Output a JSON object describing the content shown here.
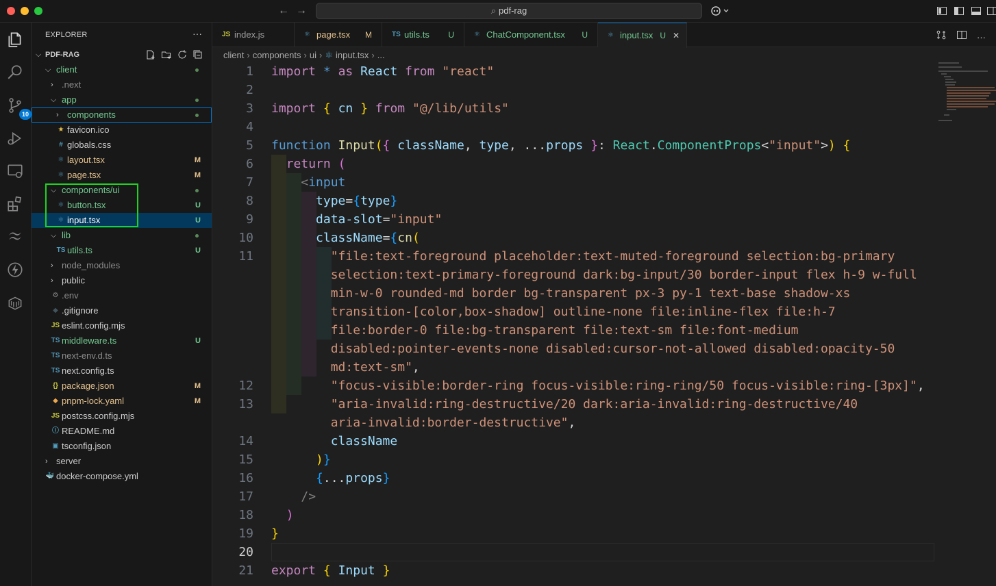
{
  "window": {
    "search_text": "pdf-rag"
  },
  "activity_bar": {
    "items": [
      {
        "name": "explorer-icon"
      },
      {
        "name": "search-icon"
      },
      {
        "name": "source-control-icon",
        "badge": "10"
      },
      {
        "name": "run-debug-icon"
      },
      {
        "name": "remote-explorer-icon"
      },
      {
        "name": "extensions-icon"
      },
      {
        "name": "tailwind-icon"
      },
      {
        "name": "thunder-icon"
      },
      {
        "name": "docker-icon"
      }
    ]
  },
  "sidebar": {
    "title": "EXPLORER",
    "more": "···",
    "root": "PDF-RAG",
    "tree": [
      {
        "label": "client",
        "indent": 1,
        "kind": "folder-open",
        "color": "#73c991",
        "dot": true
      },
      {
        "label": ".next",
        "indent": 2,
        "kind": "folder",
        "color": "#8c8c8c"
      },
      {
        "label": "app",
        "indent": 2,
        "kind": "folder-open",
        "color": "#73c991",
        "dot": true
      },
      {
        "label": "components",
        "indent": 3,
        "kind": "folder",
        "color": "#73c991",
        "dot": true,
        "focused": true
      },
      {
        "label": "favicon.ico",
        "indent": 3,
        "kind": "file",
        "icon": "★",
        "icon_color": "#e8c34d",
        "color": "#cccccc"
      },
      {
        "label": "globals.css",
        "indent": 3,
        "kind": "file",
        "icon": "#",
        "icon_color": "#519aba",
        "color": "#cccccc"
      },
      {
        "label": "layout.tsx",
        "indent": 3,
        "kind": "file",
        "icon": "⚛",
        "icon_color": "#519aba",
        "color": "#e2c08d",
        "status": "M",
        "status_color": "#e2c08d"
      },
      {
        "label": "page.tsx",
        "indent": 3,
        "kind": "file",
        "icon": "⚛",
        "icon_color": "#519aba",
        "color": "#e2c08d",
        "status": "M",
        "status_color": "#e2c08d"
      },
      {
        "label": "components/ui",
        "indent": 2,
        "kind": "folder-open",
        "color": "#73c991",
        "dot": true
      },
      {
        "label": "button.tsx",
        "indent": 3,
        "kind": "file",
        "icon": "⚛",
        "icon_color": "#519aba",
        "color": "#73c991",
        "status": "U",
        "status_color": "#73c991"
      },
      {
        "label": "input.tsx",
        "indent": 3,
        "kind": "file",
        "icon": "⚛",
        "icon_color": "#519aba",
        "color": "#ffffff",
        "status": "U",
        "status_color": "#73c991",
        "selected": true
      },
      {
        "label": "lib",
        "indent": 2,
        "kind": "folder-open",
        "color": "#73c991",
        "dot": true
      },
      {
        "label": "utils.ts",
        "indent": 3,
        "kind": "file",
        "icon": "TS",
        "icon_color": "#519aba",
        "color": "#73c991",
        "status": "U",
        "status_color": "#73c991"
      },
      {
        "label": "node_modules",
        "indent": 2,
        "kind": "folder",
        "color": "#8c8c8c"
      },
      {
        "label": "public",
        "indent": 2,
        "kind": "folder",
        "color": "#cccccc"
      },
      {
        "label": ".env",
        "indent": 2,
        "kind": "file",
        "icon": "⚙",
        "icon_color": "#8c8c8c",
        "color": "#8c8c8c"
      },
      {
        "label": ".gitignore",
        "indent": 2,
        "kind": "file",
        "icon": "◆",
        "icon_color": "#41535b",
        "color": "#cccccc"
      },
      {
        "label": "eslint.config.mjs",
        "indent": 2,
        "kind": "file",
        "icon": "JS",
        "icon_color": "#cbcb41",
        "color": "#cccccc"
      },
      {
        "label": "middleware.ts",
        "indent": 2,
        "kind": "file",
        "icon": "TS",
        "icon_color": "#519aba",
        "color": "#73c991",
        "status": "U",
        "status_color": "#73c991"
      },
      {
        "label": "next-env.d.ts",
        "indent": 2,
        "kind": "file",
        "icon": "TS",
        "icon_color": "#519aba",
        "color": "#8c8c8c"
      },
      {
        "label": "next.config.ts",
        "indent": 2,
        "kind": "file",
        "icon": "TS",
        "icon_color": "#519aba",
        "color": "#cccccc"
      },
      {
        "label": "package.json",
        "indent": 2,
        "kind": "file",
        "icon": "{}",
        "icon_color": "#cbcb41",
        "color": "#e2c08d",
        "status": "M",
        "status_color": "#e2c08d"
      },
      {
        "label": "pnpm-lock.yaml",
        "indent": 2,
        "kind": "file",
        "icon": "◆",
        "icon_color": "#e8a64d",
        "color": "#e2c08d",
        "status": "M",
        "status_color": "#e2c08d"
      },
      {
        "label": "postcss.config.mjs",
        "indent": 2,
        "kind": "file",
        "icon": "JS",
        "icon_color": "#cbcb41",
        "color": "#cccccc"
      },
      {
        "label": "README.md",
        "indent": 2,
        "kind": "file",
        "icon": "ⓘ",
        "icon_color": "#519aba",
        "color": "#cccccc"
      },
      {
        "label": "tsconfig.json",
        "indent": 2,
        "kind": "file",
        "icon": "▣",
        "icon_color": "#519aba",
        "color": "#cccccc"
      },
      {
        "label": "server",
        "indent": 1,
        "kind": "folder",
        "color": "#cccccc"
      },
      {
        "label": "docker-compose.yml",
        "indent": 1,
        "kind": "file",
        "icon": "🐳",
        "icon_color": "#e8474d",
        "color": "#cccccc"
      }
    ]
  },
  "tabs": [
    {
      "icon": "JS",
      "icon_color": "#cbcb41",
      "label": "index.js",
      "status": "",
      "color": "#9d9d9d"
    },
    {
      "icon": "⚛",
      "icon_color": "#519aba",
      "label": "page.tsx",
      "status": "M",
      "color": "#e2c08d"
    },
    {
      "icon": "TS",
      "icon_color": "#519aba",
      "label": "utils.ts",
      "status": "U",
      "color": "#73c991"
    },
    {
      "icon": "⚛",
      "icon_color": "#519aba",
      "label": "ChatComponent.tsx",
      "status": "U",
      "color": "#73c991"
    },
    {
      "icon": "⚛",
      "icon_color": "#519aba",
      "label": "input.tsx",
      "status": "U",
      "color": "#73c991",
      "active": true,
      "close": "✕"
    }
  ],
  "breadcrumb": [
    "client",
    "components",
    "ui",
    "input.tsx",
    "..."
  ],
  "editor": {
    "current_line": "20",
    "lines": [
      {
        "n": "1",
        "tokens": [
          [
            "import",
            "kc"
          ],
          [
            " ",
            "p"
          ],
          [
            "*",
            "k"
          ],
          [
            " ",
            "p"
          ],
          [
            "as",
            "kc"
          ],
          [
            " ",
            "p"
          ],
          [
            "React",
            "v"
          ],
          [
            " ",
            "p"
          ],
          [
            "from",
            "kc"
          ],
          [
            " ",
            "p"
          ],
          [
            "\"react\"",
            "s"
          ]
        ]
      },
      {
        "n": "2",
        "tokens": []
      },
      {
        "n": "3",
        "tokens": [
          [
            "import",
            "kc"
          ],
          [
            " ",
            "p"
          ],
          [
            "{",
            "b1"
          ],
          [
            " ",
            "p"
          ],
          [
            "cn",
            "v"
          ],
          [
            " ",
            "p"
          ],
          [
            "}",
            "b1"
          ],
          [
            " ",
            "p"
          ],
          [
            "from",
            "kc"
          ],
          [
            " ",
            "p"
          ],
          [
            "\"@/lib/utils\"",
            "s"
          ]
        ]
      },
      {
        "n": "4",
        "tokens": []
      },
      {
        "n": "5",
        "tokens": [
          [
            "function",
            "k"
          ],
          [
            " ",
            "p"
          ],
          [
            "Input",
            "f"
          ],
          [
            "(",
            "b1"
          ],
          [
            "{",
            "b2"
          ],
          [
            " ",
            "p"
          ],
          [
            "className",
            "v"
          ],
          [
            ", ",
            "p"
          ],
          [
            "type",
            "v"
          ],
          [
            ", ",
            "p"
          ],
          [
            "...",
            "p"
          ],
          [
            "props",
            "v"
          ],
          [
            " ",
            "p"
          ],
          [
            "}",
            "b2"
          ],
          [
            ": ",
            "p"
          ],
          [
            "React",
            "t"
          ],
          [
            ".",
            "p"
          ],
          [
            "ComponentProps",
            "t"
          ],
          [
            "<",
            "p"
          ],
          [
            "\"input\"",
            "s"
          ],
          [
            ">",
            "p"
          ],
          [
            ")",
            "b1"
          ],
          [
            " ",
            "p"
          ],
          [
            "{",
            "b1"
          ]
        ]
      },
      {
        "n": "6",
        "tokens": [
          [
            "  ",
            "p"
          ],
          [
            "return",
            "kc"
          ],
          [
            " ",
            "p"
          ],
          [
            "(",
            "b2"
          ]
        ]
      },
      {
        "n": "7",
        "tokens": [
          [
            "    ",
            "p"
          ],
          [
            "<",
            "tg"
          ],
          [
            "input",
            "k"
          ]
        ]
      },
      {
        "n": "8",
        "tokens": [
          [
            "      ",
            "p"
          ],
          [
            "type",
            "v"
          ],
          [
            "=",
            "p"
          ],
          [
            "{",
            "b3"
          ],
          [
            "type",
            "v"
          ],
          [
            "}",
            "b3"
          ]
        ]
      },
      {
        "n": "9",
        "tokens": [
          [
            "      ",
            "p"
          ],
          [
            "data-slot",
            "v"
          ],
          [
            "=",
            "p"
          ],
          [
            "\"input\"",
            "s"
          ]
        ]
      },
      {
        "n": "10",
        "tokens": [
          [
            "      ",
            "p"
          ],
          [
            "className",
            "v"
          ],
          [
            "=",
            "p"
          ],
          [
            "{",
            "b3"
          ],
          [
            "cn",
            "f"
          ],
          [
            "(",
            "b1"
          ]
        ]
      },
      {
        "n": "11",
        "tokens": [
          [
            "        ",
            "p"
          ],
          [
            "\"file:text-foreground placeholder:text-muted-foreground selection:bg-primary",
            "s"
          ]
        ]
      },
      {
        "n": "",
        "tokens": [
          [
            "        ",
            "p"
          ],
          [
            "selection:text-primary-foreground dark:bg-input/30 border-input flex h-9 w-full",
            "s"
          ]
        ]
      },
      {
        "n": "",
        "tokens": [
          [
            "        ",
            "p"
          ],
          [
            "min-w-0 rounded-md border bg-transparent px-3 py-1 text-base shadow-xs",
            "s"
          ]
        ]
      },
      {
        "n": "",
        "tokens": [
          [
            "        ",
            "p"
          ],
          [
            "transition-[color,box-shadow] outline-none file:inline-flex file:h-7",
            "s"
          ]
        ]
      },
      {
        "n": "",
        "tokens": [
          [
            "        ",
            "p"
          ],
          [
            "file:border-0 file:bg-transparent file:text-sm file:font-medium",
            "s"
          ]
        ]
      },
      {
        "n": "",
        "tokens": [
          [
            "        ",
            "p"
          ],
          [
            "disabled:pointer-events-none disabled:cursor-not-allowed disabled:opacity-50",
            "s"
          ]
        ]
      },
      {
        "n": "",
        "tokens": [
          [
            "        ",
            "p"
          ],
          [
            "md:text-sm\"",
            "s"
          ],
          [
            ",",
            "p"
          ]
        ]
      },
      {
        "n": "12",
        "tokens": [
          [
            "        ",
            "p"
          ],
          [
            "\"focus-visible:border-ring focus-visible:ring-ring/50 focus-visible:ring-[3px]\"",
            "s"
          ],
          [
            ",",
            "p"
          ]
        ]
      },
      {
        "n": "13",
        "tokens": [
          [
            "        ",
            "p"
          ],
          [
            "\"aria-invalid:ring-destructive/20 dark:aria-invalid:ring-destructive/40",
            "s"
          ]
        ]
      },
      {
        "n": "",
        "tokens": [
          [
            "        ",
            "p"
          ],
          [
            "aria-invalid:border-destructive\"",
            "s"
          ],
          [
            ",",
            "p"
          ]
        ]
      },
      {
        "n": "14",
        "tokens": [
          [
            "        ",
            "p"
          ],
          [
            "className",
            "v"
          ]
        ]
      },
      {
        "n": "15",
        "tokens": [
          [
            "      ",
            "p"
          ],
          [
            ")",
            "b1"
          ],
          [
            "}",
            "b3"
          ]
        ]
      },
      {
        "n": "16",
        "tokens": [
          [
            "      ",
            "p"
          ],
          [
            "{",
            "b3"
          ],
          [
            "...",
            "p"
          ],
          [
            "props",
            "v"
          ],
          [
            "}",
            "b3"
          ]
        ]
      },
      {
        "n": "17",
        "tokens": [
          [
            "    ",
            "p"
          ],
          [
            "/>",
            "tg"
          ]
        ]
      },
      {
        "n": "18",
        "tokens": [
          [
            "  ",
            "p"
          ],
          [
            ")",
            "b2"
          ]
        ]
      },
      {
        "n": "19",
        "tokens": [
          [
            "}",
            "b1"
          ]
        ]
      },
      {
        "n": "20",
        "tokens": []
      },
      {
        "n": "21",
        "tokens": [
          [
            "export",
            "kc"
          ],
          [
            " ",
            "p"
          ],
          [
            "{",
            "b1"
          ],
          [
            " ",
            "p"
          ],
          [
            "Input",
            "v"
          ],
          [
            " ",
            "p"
          ],
          [
            "}",
            "b1"
          ]
        ]
      }
    ]
  }
}
